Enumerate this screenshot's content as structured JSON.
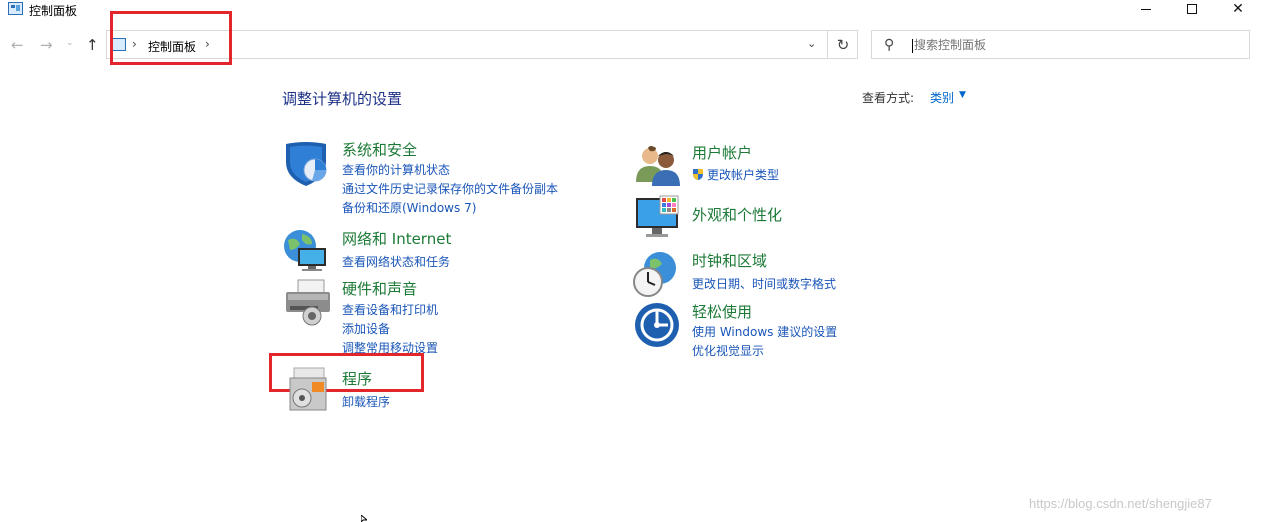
{
  "window": {
    "title": "控制面板",
    "minimize_glyph": "",
    "maximize_glyph": "",
    "close_glyph": "✕"
  },
  "nav": {
    "back_glyph": "←",
    "forward_glyph": "→",
    "recent_glyph": "⌄",
    "up_glyph": "↑",
    "separator": "›",
    "breadcrumb": "控制面板",
    "dropdown_glyph": "⌄",
    "refresh_glyph": "↻",
    "search_placeholder": "搜索控制面板"
  },
  "header": {
    "title": "调整计算机的设置",
    "view_by_label": "查看方式:",
    "view_by_value": "类别",
    "view_by_arrow": "▼"
  },
  "categories": {
    "system_security": {
      "icon": "shield-icon",
      "title": "系统和安全",
      "links": [
        "查看你的计算机状态",
        "通过文件历史记录保存你的文件备份副本",
        "备份和还原(Windows 7)"
      ]
    },
    "network": {
      "icon": "network-globe-icon",
      "title": "网络和 Internet",
      "links": [
        "查看网络状态和任务"
      ]
    },
    "hardware_sound": {
      "icon": "printer-icon",
      "title": "硬件和声音",
      "links": [
        "查看设备和打印机",
        "添加设备",
        "调整常用移动设置"
      ]
    },
    "programs": {
      "icon": "programs-box-icon",
      "title": "程序",
      "links": [
        "卸载程序"
      ]
    },
    "user_accounts": {
      "icon": "users-icon",
      "title": "用户帐户",
      "links": [
        "更改帐户类型"
      ]
    },
    "appearance": {
      "icon": "monitor-palette-icon",
      "title": "外观和个性化",
      "links": []
    },
    "clock_region": {
      "icon": "clock-globe-icon",
      "title": "时钟和区域",
      "links": [
        "更改日期、时间或数字格式"
      ]
    },
    "ease_of_access": {
      "icon": "ease-of-access-icon",
      "title": "轻松使用",
      "links": [
        "使用 Windows 建议的设置",
        "优化视觉显示"
      ]
    }
  },
  "watermark": "https://blog.csdn.net/shengjie87",
  "colors": {
    "category_title": "#1c7a37",
    "link": "#1a56b8",
    "page_title": "#1e3287",
    "highlight": "#e3262c"
  }
}
